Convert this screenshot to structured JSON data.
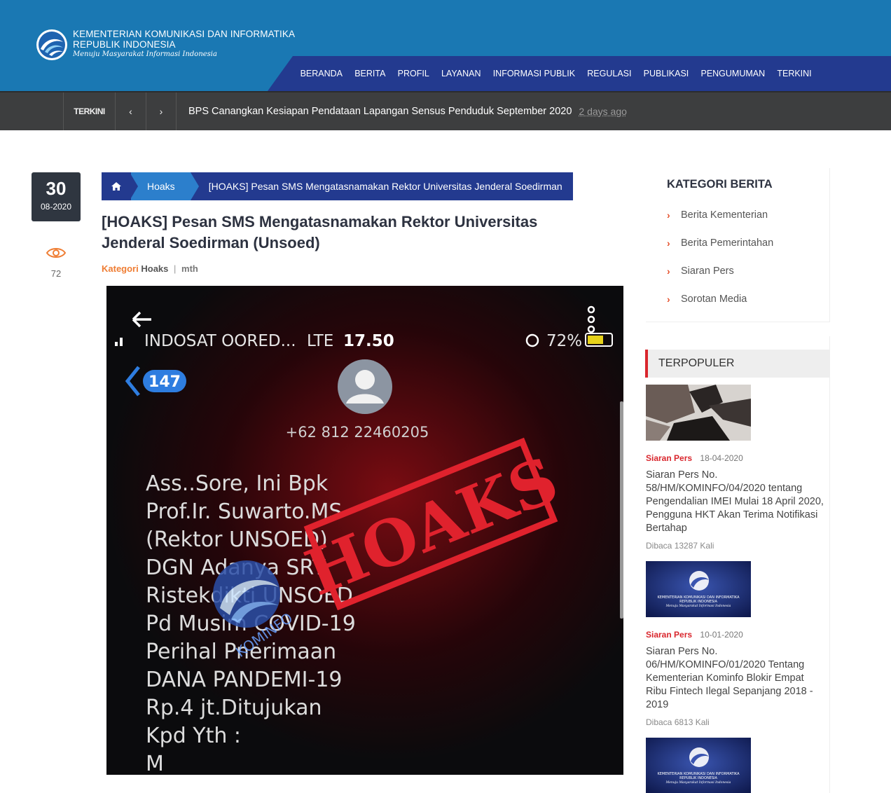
{
  "header": {
    "org_line1": "KEMENTERIAN KOMUNIKASI DAN INFORMATIKA",
    "org_line2": "REPUBLIK INDONESIA",
    "tagline": "Menuju Masyarakat Informasi Indonesia",
    "nav": [
      "BERANDA",
      "BERITA",
      "PROFIL",
      "LAYANAN",
      "INFORMASI PUBLIK",
      "REGULASI",
      "PUBLIKASI",
      "PENGUMUMAN",
      "TERKINI"
    ]
  },
  "ticker": {
    "label": "TERKINI",
    "prev": "‹",
    "next": "›",
    "headline": "BPS Canangkan Kesiapan Pendataan Lapangan Sensus Penduduk September 2020",
    "ago": "2 days ago"
  },
  "article": {
    "day": "30",
    "month_year": "08-2020",
    "views": "72",
    "breadcrumb_cat": "Hoaks",
    "breadcrumb_current": "[HOAKS] Pesan SMS Mengatasnamakan Rektor Universitas Jenderal Soedirman",
    "title": "[HOAKS] Pesan SMS Mengatasnamakan Rektor Universitas Jenderal Soedirman (Unsoed)",
    "kategori_label": "Kategori",
    "kategori": "Hoaks",
    "sep": "|",
    "author": "mth"
  },
  "photo": {
    "carrier": "INDOSAT OORED...",
    "network": "LTE",
    "time": "17.50",
    "battery": "72%",
    "badge": "147",
    "phone": "+62 812 22460205",
    "stamp": "HOAKS",
    "watermark": "KOMINFO",
    "sms_lines": [
      "Ass..Sore, Ini Bpk",
      "Prof.Ir. Suwarto.MS",
      "(Rektor UNSOED)",
      "DGN Adanya SRT",
      "Ristekdikti UNSOED",
      "Pd Musim COVID-19",
      "Perihal Pnerimaan",
      "DANA PANDEMI-19",
      "Rp.4 jt.Ditujukan",
      "Kpd Yth :",
      "M"
    ]
  },
  "sidebar": {
    "kategori_title": "KATEGORI BERITA",
    "kategori_items": [
      "Berita Kementerian",
      "Berita Pemerintahan",
      "Siaran Pers",
      "Sorotan Media"
    ],
    "terpopuler_title": "TERPOPULER",
    "popular": [
      {
        "cat": "Siaran Pers",
        "date": "18-04-2020",
        "title": "Siaran Pers No. 58/HM/KOMINFO/04/2020 tentang Pengendalian IMEI Mulai 18 April 2020, Pengguna HKT Akan Terima Notifikasi Bertahap",
        "reads": "Dibaca 13287 Kali"
      },
      {
        "cat": "Siaran Pers",
        "date": "10-01-2020",
        "title": "Siaran Pers No. 06/HM/KOMINFO/01/2020 Tentang Kementerian Kominfo Blokir Empat Ribu Fintech Ilegal Sepanjang 2018 - 2019",
        "reads": "Dibaca 6813 Kali"
      }
    ],
    "thumb_line1": "KEMENTERIAN KOMUNIKASI DAN INFORMATIKA",
    "thumb_line2": "REPUBLIK INDONESIA",
    "thumb_tagline": "Menuju Masyarakat Informasi Indonesia"
  },
  "colors": {
    "header_blue": "#1a78b3",
    "nav_navy": "#233a8f",
    "accent_red": "#d9262d",
    "accent_orange": "#ef7d33"
  }
}
